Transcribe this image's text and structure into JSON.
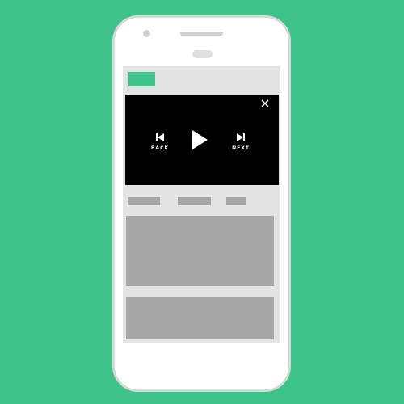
{
  "device": {
    "frame_color": "#ffffff",
    "background_color": "#3ec48b"
  },
  "header": {
    "logo_color": "#3ec48b"
  },
  "player": {
    "close_icon": "close-icon",
    "back_label": "BACK",
    "back_icon": "skip-previous-icon",
    "play_icon": "play-icon",
    "next_label": "NEXT",
    "next_icon": "skip-next-icon"
  },
  "tabs": [
    "",
    "",
    ""
  ],
  "cards": [
    "",
    ""
  ]
}
